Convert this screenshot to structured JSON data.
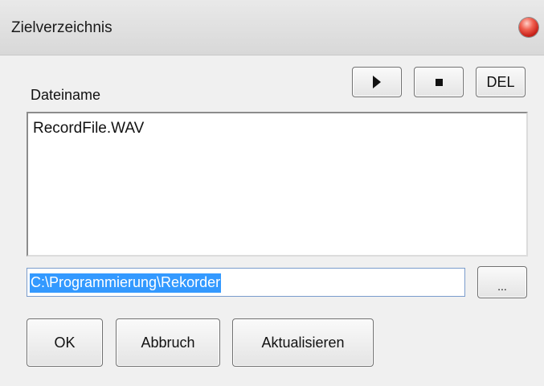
{
  "window": {
    "title": "Zielverzeichnis"
  },
  "toolbar": {
    "play_icon": "play-icon",
    "stop_icon": "stop-icon",
    "delete_label": "DEL"
  },
  "file_list": {
    "header_label": "Dateiname",
    "items": [
      "RecordFile.WAV"
    ]
  },
  "path": {
    "value": "C:\\Programmierung\\Rekorder",
    "browse_label": "..."
  },
  "actions": {
    "ok_label": "OK",
    "cancel_label": "Abbruch",
    "refresh_label": "Aktualisieren"
  },
  "colors": {
    "selection": "#3399ff",
    "close_button": "#e04030"
  }
}
